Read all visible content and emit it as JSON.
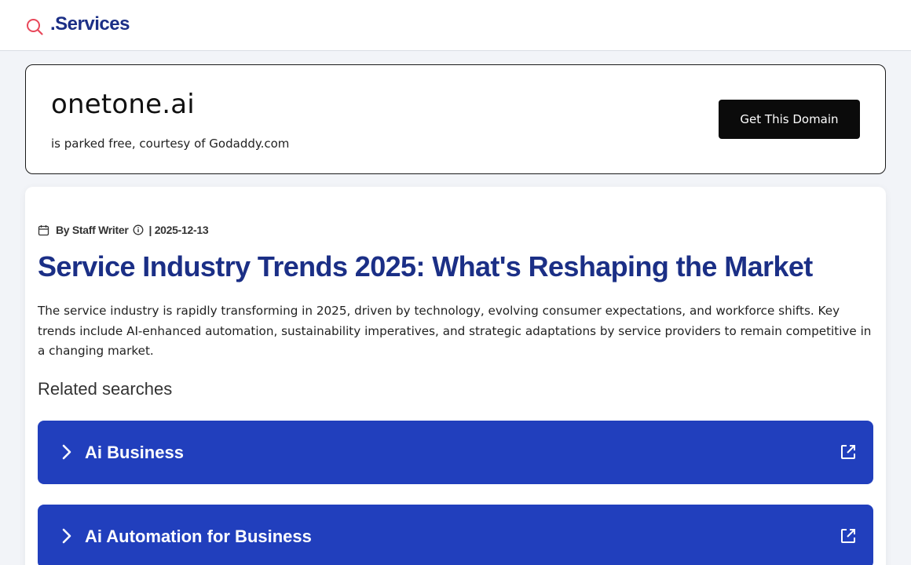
{
  "header": {
    "logo_text": ".Services",
    "logo_icon": "search-icon",
    "accent_color": "#e8485a",
    "brand_color": "#1b2f86"
  },
  "domain_banner": {
    "domain": "onetone.ai",
    "subtitle": "is parked free, courtesy of Godaddy.com",
    "cta_label": "Get This Domain"
  },
  "article": {
    "author": "By Staff Writer",
    "date": "| 2025-12-13",
    "title": "Service Industry Trends 2025: What's Reshaping the Market",
    "summary": "The service industry is rapidly transforming in 2025, driven by technology, evolving consumer expectations, and workforce shifts. Key trends include AI-enhanced automation, sustainability imperatives, and strategic adaptations by service providers to remain competitive in a changing market."
  },
  "related": {
    "heading": "Related searches",
    "items": [
      {
        "label": "Ai Business"
      },
      {
        "label": "Ai Automation for Business"
      }
    ],
    "item_color": "#213fbd"
  }
}
